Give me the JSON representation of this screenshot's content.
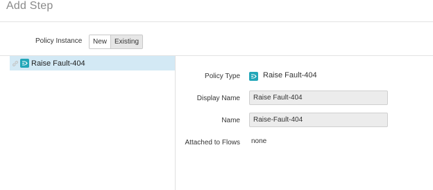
{
  "header": {
    "title": "Add Step"
  },
  "policy_instance": {
    "label": "Policy Instance",
    "options": [
      "New",
      "Existing"
    ],
    "selected": "Existing"
  },
  "tree": {
    "items": [
      {
        "label": "Raise Fault-404",
        "icon": "raise-fault-policy-icon",
        "selected": true
      }
    ]
  },
  "details": {
    "policy_type_label": "Policy Type",
    "policy_type_value": "Raise Fault-404",
    "display_name_label": "Display Name",
    "display_name_value": "Raise Fault-404",
    "name_label": "Name",
    "name_value": "Raise-Fault-404",
    "attached_label": "Attached to Flows",
    "attached_value": "none"
  },
  "colors": {
    "selection": "#d3e9f5",
    "policy_icon": "#22a6b8"
  }
}
